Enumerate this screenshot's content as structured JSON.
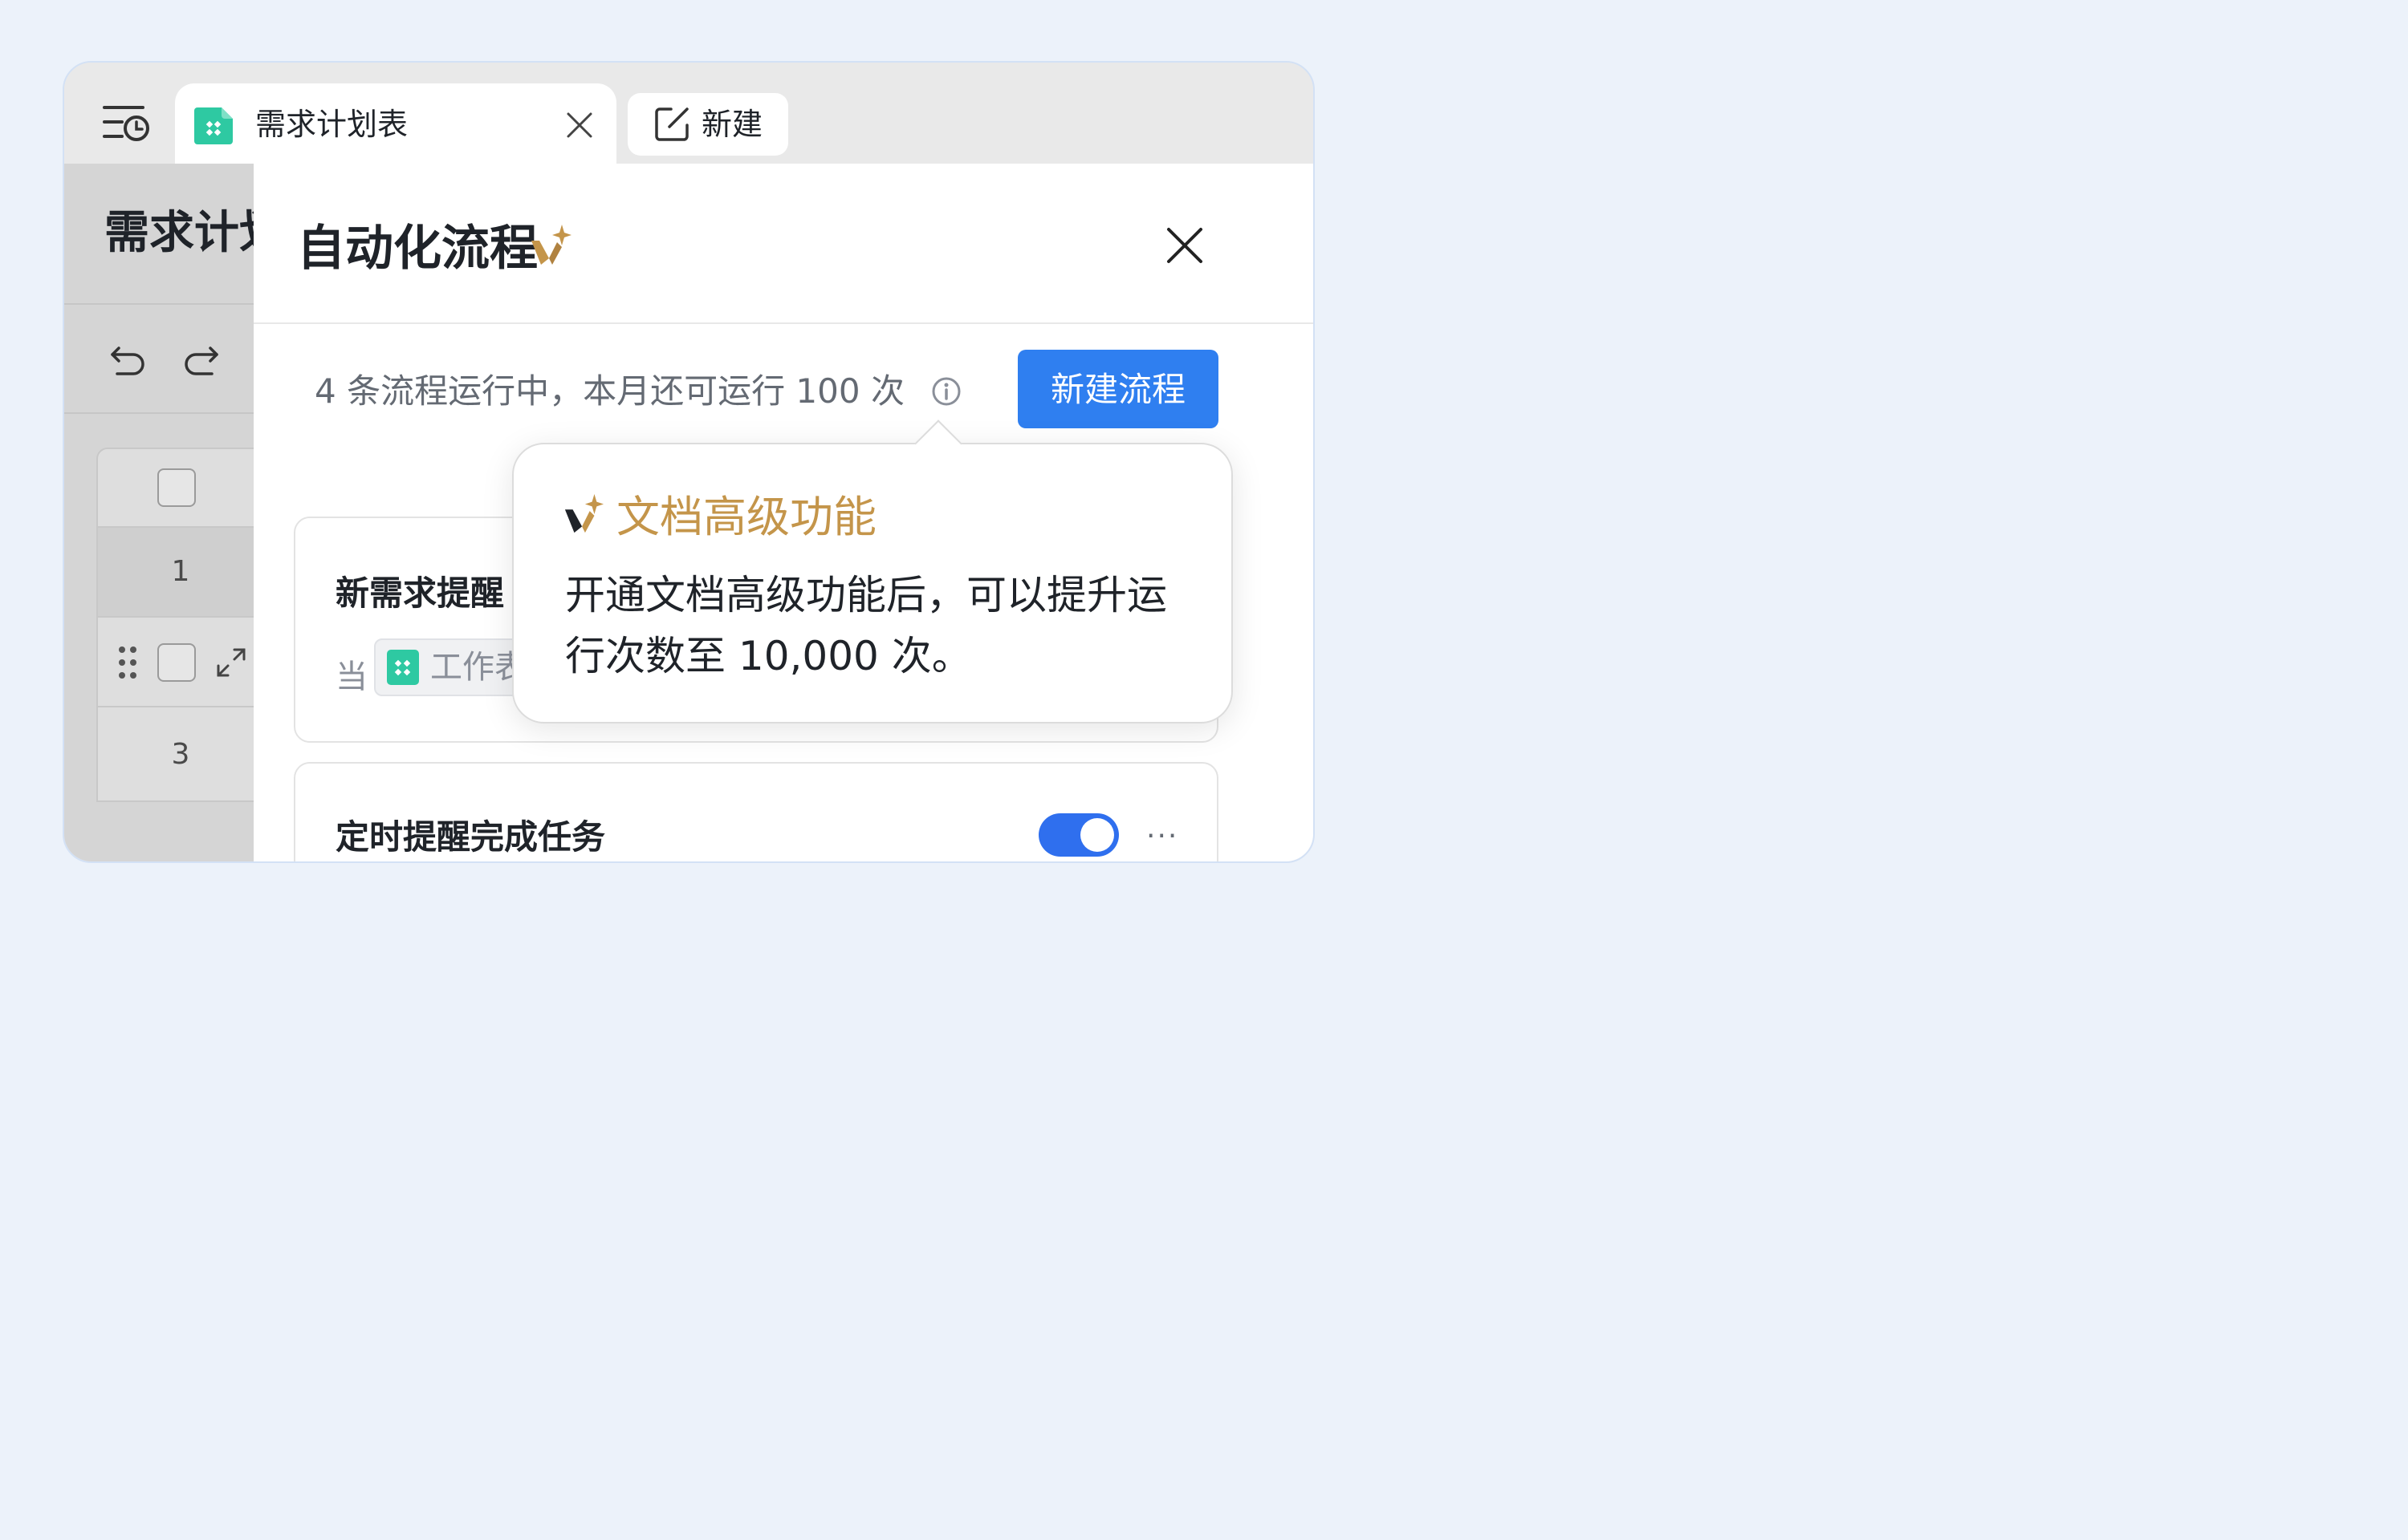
{
  "tabs": {
    "active": {
      "title": "需求计划表"
    },
    "new_tab": {
      "label": "新建"
    }
  },
  "document": {
    "title": "需求计划",
    "rows": [
      "1",
      "3"
    ]
  },
  "panel": {
    "title": "自动化流程",
    "status_text": "4 条流程运行中，本月还可运行 100 次",
    "new_flow_button": "新建流程",
    "cards": [
      {
        "title": "新需求提醒",
        "condition_prefix": "当",
        "condition_chip": "工作表"
      },
      {
        "title": "定时提醒完成任务",
        "enabled": true
      }
    ]
  },
  "popover": {
    "title": "文档高级功能",
    "body": "开通文档高级功能后，可以提升运行次数至 10,000 次。"
  },
  "colors": {
    "primary": "#2f7ff0",
    "gold": "#c4954a",
    "sheet_green": "#2ec9a2"
  },
  "icons": [
    "history-icon",
    "sheet-icon",
    "close-icon",
    "new-doc-icon",
    "undo-icon",
    "redo-icon",
    "sparkle-icon",
    "info-icon",
    "drag-handle-icon",
    "expand-icon",
    "more-icon"
  ]
}
